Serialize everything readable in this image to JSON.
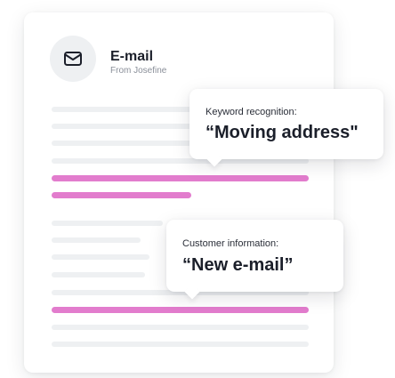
{
  "email": {
    "title": "E-mail",
    "from": "From Josefine",
    "icon": "envelope-icon"
  },
  "callouts": {
    "keyword": {
      "label": "Keyword recognition:",
      "value": "“Moving address\""
    },
    "customer": {
      "label": "Customer information:",
      "value": "“New e-mail”"
    }
  },
  "colors": {
    "highlight": "#e27ccd",
    "placeholder_line": "#eef0f2",
    "avatar_bg": "#eef0f2",
    "text_primary": "#1b1f2a",
    "text_secondary": "#8a8f99"
  }
}
